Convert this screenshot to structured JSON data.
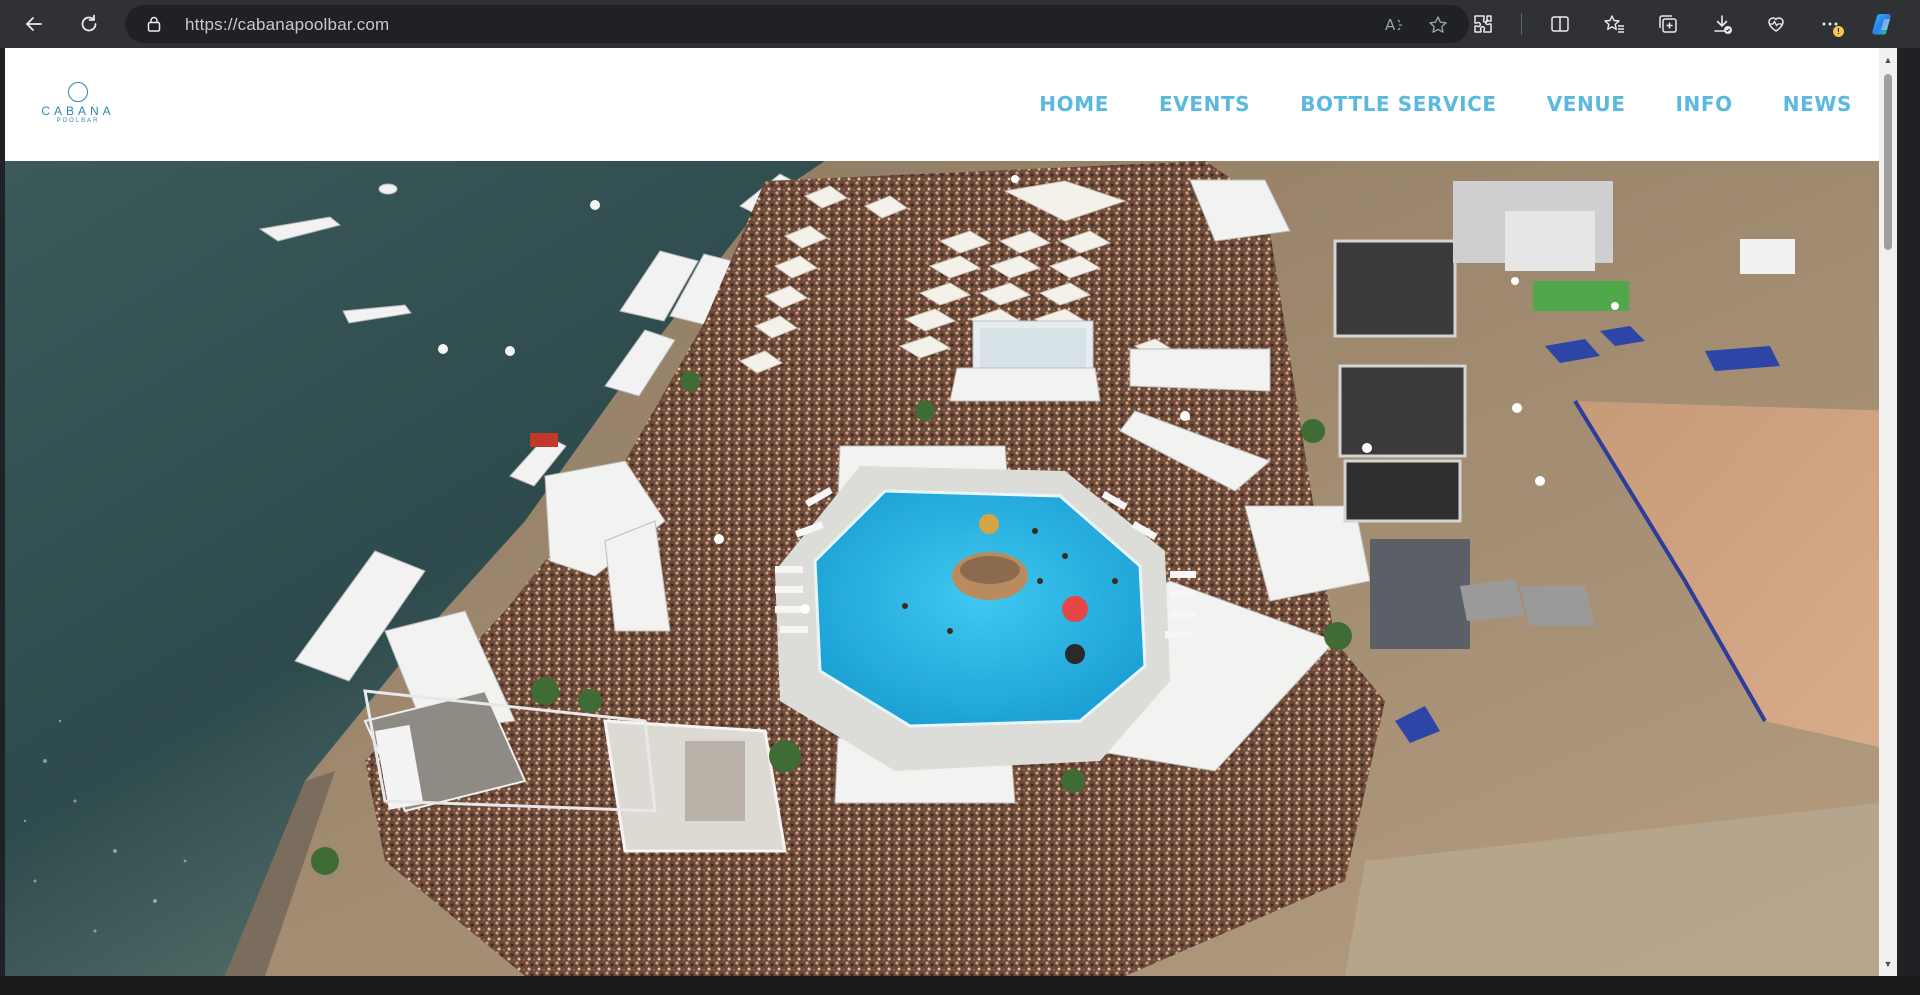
{
  "browser": {
    "url": "https://cabanapoolbar.com",
    "icons": {
      "back": "back-arrow-icon",
      "refresh": "refresh-icon",
      "lock": "lock-icon",
      "read_aloud": "read-aloud-icon",
      "favorite": "star-icon",
      "extensions": "puzzle-icon",
      "split_screen": "split-screen-icon",
      "favorites": "favorites-icon",
      "collections": "collections-icon",
      "downloads": "download-icon",
      "performance": "heart-pulse-icon",
      "more": "more-icon",
      "copilot": "copilot-icon"
    }
  },
  "site": {
    "logo": {
      "wordmark": "CABANA",
      "sub": "POOLBAR"
    },
    "nav": [
      {
        "label": "HOME"
      },
      {
        "label": "EVENTS"
      },
      {
        "label": "BOTTLE SERVICE"
      },
      {
        "label": "VENUE"
      },
      {
        "label": "INFO"
      },
      {
        "label": "NEWS"
      }
    ],
    "hero": {
      "description_icon": "aerial-photo-pool-party"
    }
  },
  "colors": {
    "nav_text": "#5bb8df",
    "logo": "#2f86b0",
    "chrome_bg": "#303134",
    "urlbar_bg": "#202124",
    "water": "#2f4d4f",
    "pool": "#2ab4e0"
  }
}
